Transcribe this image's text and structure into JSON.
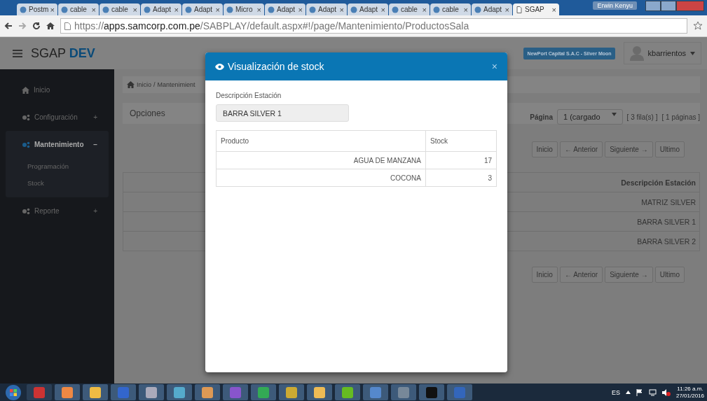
{
  "browser": {
    "tabs": [
      {
        "label": "Postm",
        "selected": false
      },
      {
        "label": "cable",
        "selected": false
      },
      {
        "label": "cable",
        "selected": false
      },
      {
        "label": "Adapt",
        "selected": false
      },
      {
        "label": "Adapt",
        "selected": false
      },
      {
        "label": "Micro",
        "selected": false
      },
      {
        "label": "Adapt",
        "selected": false
      },
      {
        "label": "Adapt",
        "selected": false
      },
      {
        "label": "Adapt",
        "selected": false
      },
      {
        "label": "cable",
        "selected": false
      },
      {
        "label": "cable",
        "selected": false
      },
      {
        "label": "Adapt",
        "selected": false
      },
      {
        "label": "SGAP",
        "selected": true
      }
    ],
    "tab_close": "×",
    "window_user": "Erwin Kenyu",
    "url": "https://**apps.samcorp.com.pe**/SABPLAY/default.aspx#!/page/Mantenimiento/ProductosSala"
  },
  "app": {
    "brand": "SGAP",
    "brand_suffix": "DEV",
    "company": "NewPort Capital S.A.C - Silver Moon",
    "user": "kbarrientos",
    "sidebar": {
      "items": [
        {
          "label": "Inicio",
          "expanded": false
        },
        {
          "label": "Configuración",
          "toggle": "+",
          "expanded": false
        },
        {
          "label": "Mantenimiento",
          "toggle": "−",
          "expanded": true,
          "children": [
            {
              "label": "Programación"
            },
            {
              "label": "Stock"
            }
          ]
        },
        {
          "label": "Reporte",
          "toggle": "+",
          "expanded": false
        }
      ]
    },
    "breadcrumb": [
      "Inicio",
      "/",
      "Mantenimient"
    ],
    "panel_title": "Opciones",
    "pager": {
      "label": "Página",
      "select_value": "1 (cargado",
      "rows_info": "[ 3 fila(s) ]",
      "pages_info": "[ 1 páginas ]"
    },
    "pager_buttons_top": [
      "Inicio",
      "← Anterior",
      "Siguiente →",
      "Ultimo"
    ],
    "table": {
      "columns": [
        "Descripción Estación"
      ],
      "rows": [
        [
          "MATRIZ SILVER"
        ],
        [
          "BARRA SILVER 1"
        ],
        [
          "BARRA SILVER 2"
        ]
      ]
    },
    "pager_buttons_bottom": [
      "Inicio",
      "← Anterior",
      "Siguiente →",
      "Ultimo"
    ]
  },
  "modal": {
    "title": "Visualización de stock",
    "close": "×",
    "field_label": "Descripción Estación",
    "field_value": "BARRA SILVER 1",
    "table": {
      "columns": [
        "Producto",
        "Stock"
      ],
      "rows": [
        [
          "AGUA DE MANZANA",
          "17"
        ],
        [
          "COCONA",
          "3"
        ]
      ]
    }
  },
  "taskbar": {
    "language": "ES",
    "time": "11:26 a.m.",
    "date": "27/01/2016"
  }
}
